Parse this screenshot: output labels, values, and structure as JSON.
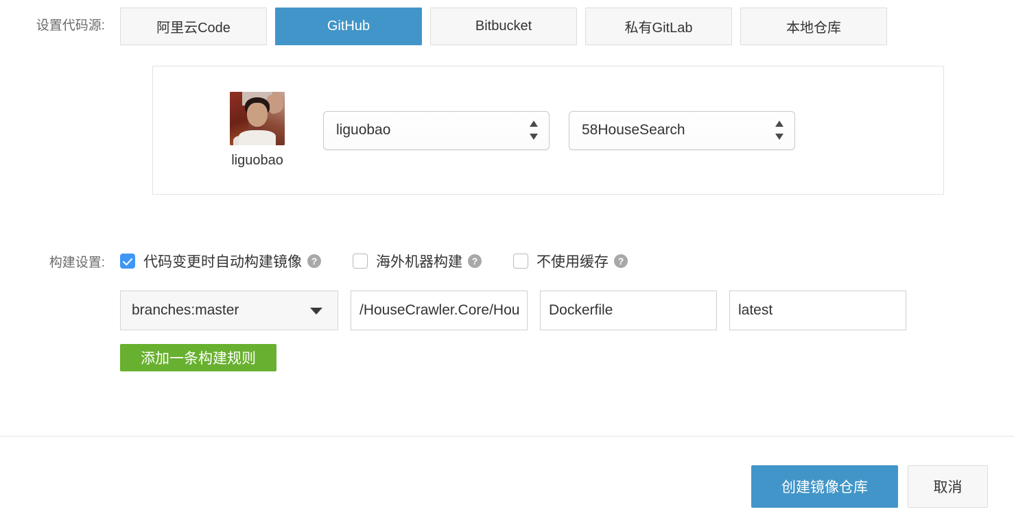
{
  "source_section": {
    "label": "设置代码源:",
    "tabs": [
      {
        "label": "阿里云Code",
        "active": false
      },
      {
        "label": "GitHub",
        "active": true
      },
      {
        "label": "Bitbucket",
        "active": false
      },
      {
        "label": "私有GitLab",
        "active": false
      },
      {
        "label": "本地仓库",
        "active": false
      }
    ]
  },
  "repo_panel": {
    "account_name": "liguobao",
    "owner_select": {
      "value": "liguobao"
    },
    "repo_select": {
      "value": "58HouseSearch"
    }
  },
  "build_section": {
    "label": "构建设置:",
    "checkboxes": [
      {
        "label": "代码变更时自动构建镜像",
        "checked": true,
        "help": "?"
      },
      {
        "label": "海外机器构建",
        "checked": false,
        "help": "?"
      },
      {
        "label": "不使用缓存",
        "checked": false,
        "help": "?"
      }
    ],
    "rule": {
      "branch_value": "branches:master",
      "context_value": "/HouseCrawler.Core/HouseCrawler.Web",
      "dockerfile_value": "Dockerfile",
      "tag_value": "latest"
    },
    "add_rule_label": "添加一条构建规则"
  },
  "footer": {
    "primary_label": "创建镜像仓库",
    "secondary_label": "取消"
  },
  "colors": {
    "accent_blue": "#4295c8",
    "checkbox_blue": "#3e97f5",
    "green": "#68b02f",
    "border_gray": "#dcdcdc",
    "label_gray": "#6b6b6b"
  }
}
